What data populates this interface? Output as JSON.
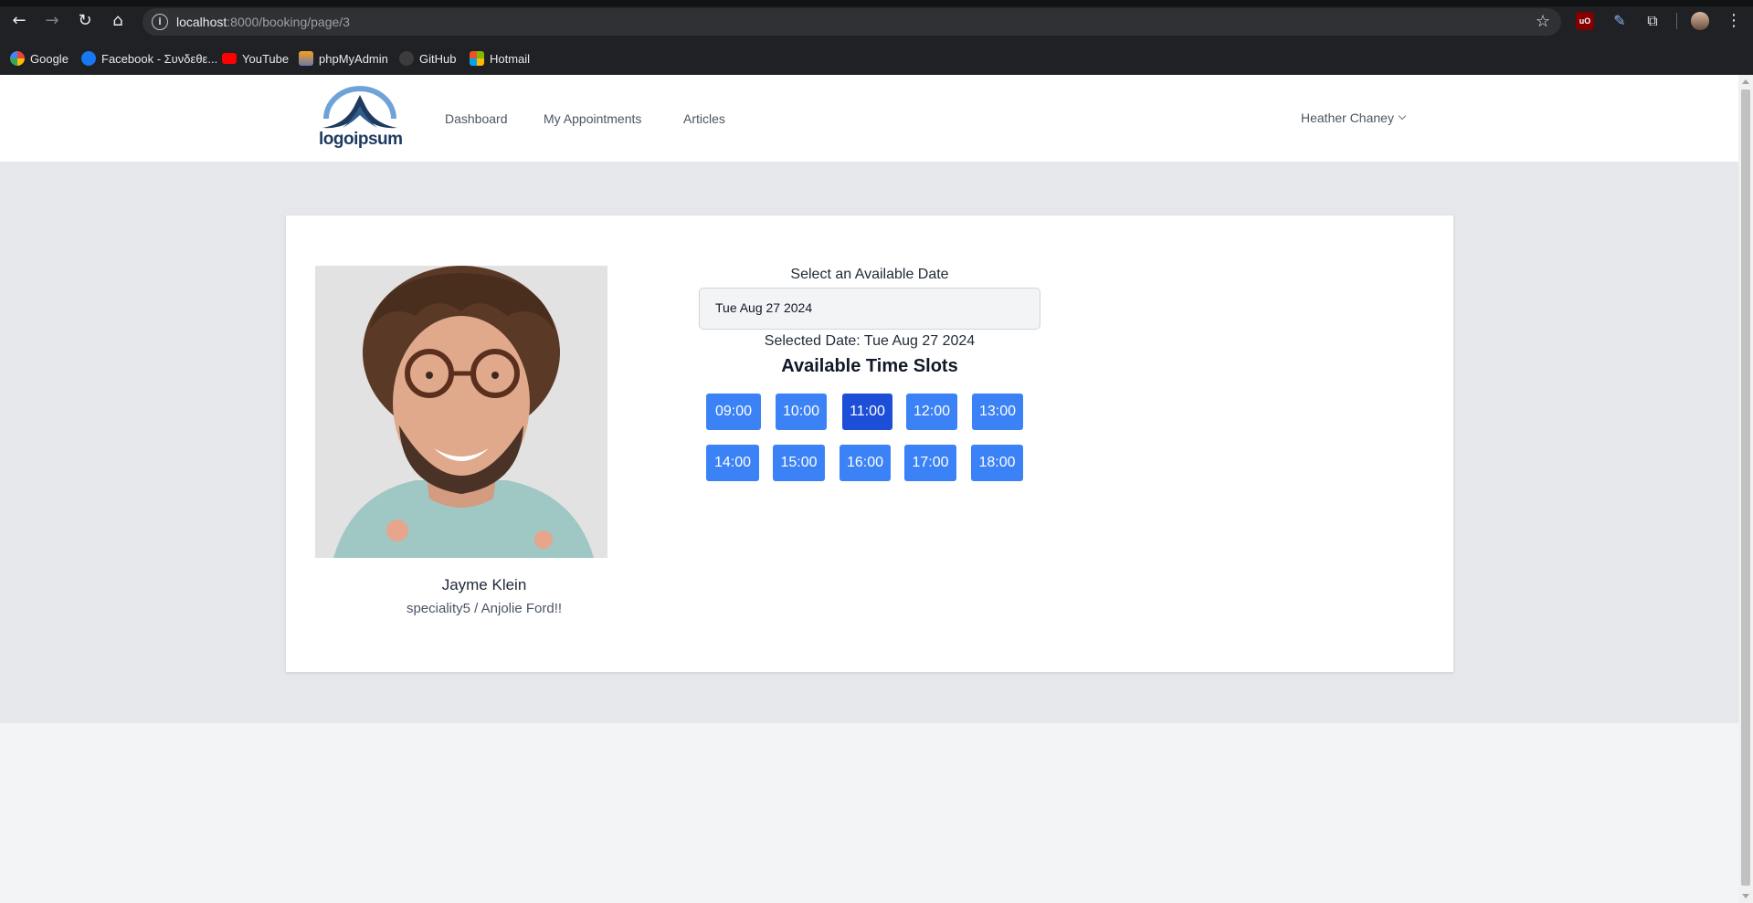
{
  "browser": {
    "url_host": "localhost",
    "url_rest": ":8000/booking/page/3",
    "bookmarks": [
      "Google",
      "Facebook - Συνδεθε...",
      "YouTube",
      "phpMyAdmin",
      "GitHub",
      "Hotmail"
    ]
  },
  "header": {
    "logo_text": "logoipsum",
    "nav": [
      "Dashboard",
      "My Appointments",
      "Articles"
    ],
    "user_name": "Heather Chaney"
  },
  "doctor": {
    "name": "Jayme Klein",
    "speciality": "speciality5 / Anjolie Ford!!"
  },
  "booking": {
    "date_label": "Select an Available Date",
    "date_value": "Tue Aug 27 2024",
    "selected_date_text": "Selected Date: Tue Aug 27 2024",
    "slots_title": "Available Time Slots",
    "slots": [
      "09:00",
      "10:00",
      "11:00",
      "12:00",
      "13:00",
      "14:00",
      "15:00",
      "16:00",
      "17:00",
      "18:00"
    ],
    "active_slot": "11:00"
  },
  "colors": {
    "slot": "#3b82f6",
    "slot_active": "#1d4ed8",
    "logo_blue": "#1e3a5f"
  }
}
